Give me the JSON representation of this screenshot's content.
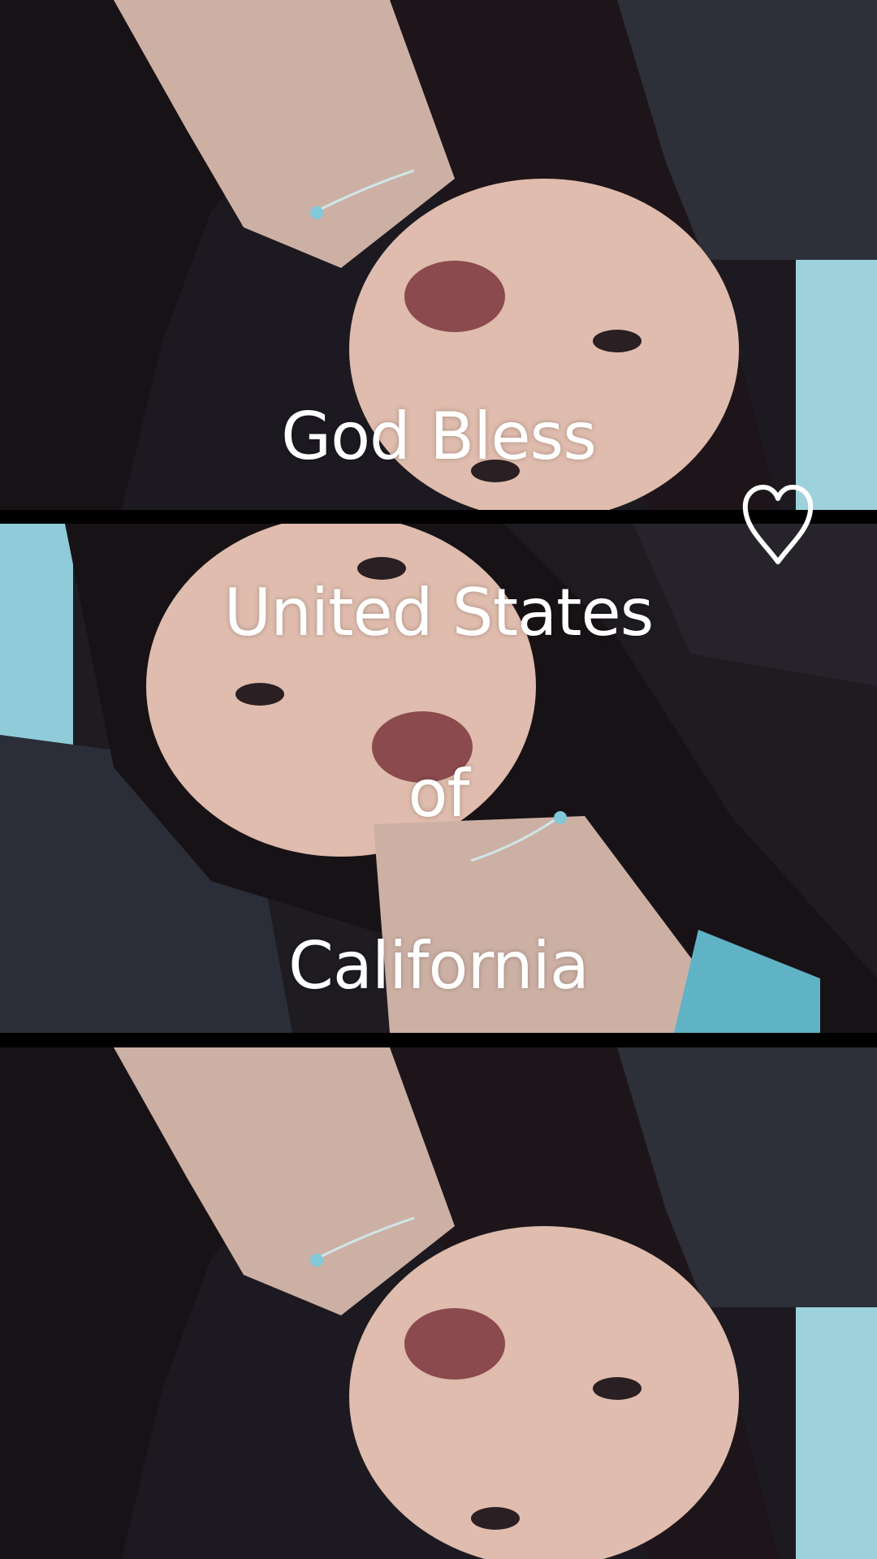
{
  "captions": {
    "line1": "God Bless",
    "line2": "United States",
    "line3": "of",
    "line4": "California"
  },
  "heart": {
    "icon": "heart-outline-icon",
    "color": "#ffffff"
  },
  "colors": {
    "caption": "#ffffff",
    "divider": "#000000",
    "hair": "#1a1416",
    "skin": "#d9b6a7",
    "lips": "#8a4a4c",
    "seat": "#2b2e38",
    "window": "#5bb8cc"
  }
}
